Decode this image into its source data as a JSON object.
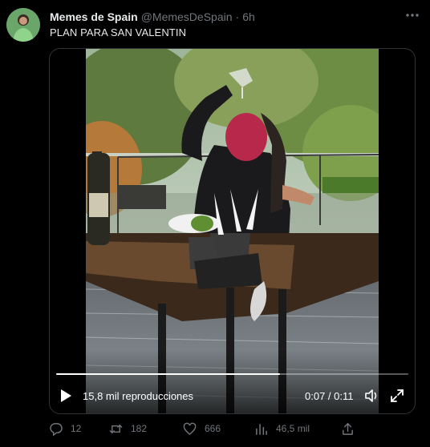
{
  "tweet": {
    "author_name": "Memes de Spain",
    "author_handle": "@MemesDeSpain",
    "separator": "·",
    "time": "6h",
    "text": "PLAN PARA SAN VALENTIN"
  },
  "video": {
    "views": "15,8 mil reproducciones",
    "timecode": "0:07 / 0:11",
    "progress": 0.636
  },
  "actions": {
    "replies": "12",
    "retweets": "182",
    "likes": "666",
    "views": "46,5 mil"
  },
  "icons": {
    "more": "more-horizontal-icon",
    "play": "play-icon",
    "volume": "volume-icon",
    "fullscreen": "fullscreen-icon",
    "reply": "reply-icon",
    "retweet": "retweet-icon",
    "like": "heart-icon",
    "analytics": "analytics-icon",
    "share": "share-icon"
  }
}
